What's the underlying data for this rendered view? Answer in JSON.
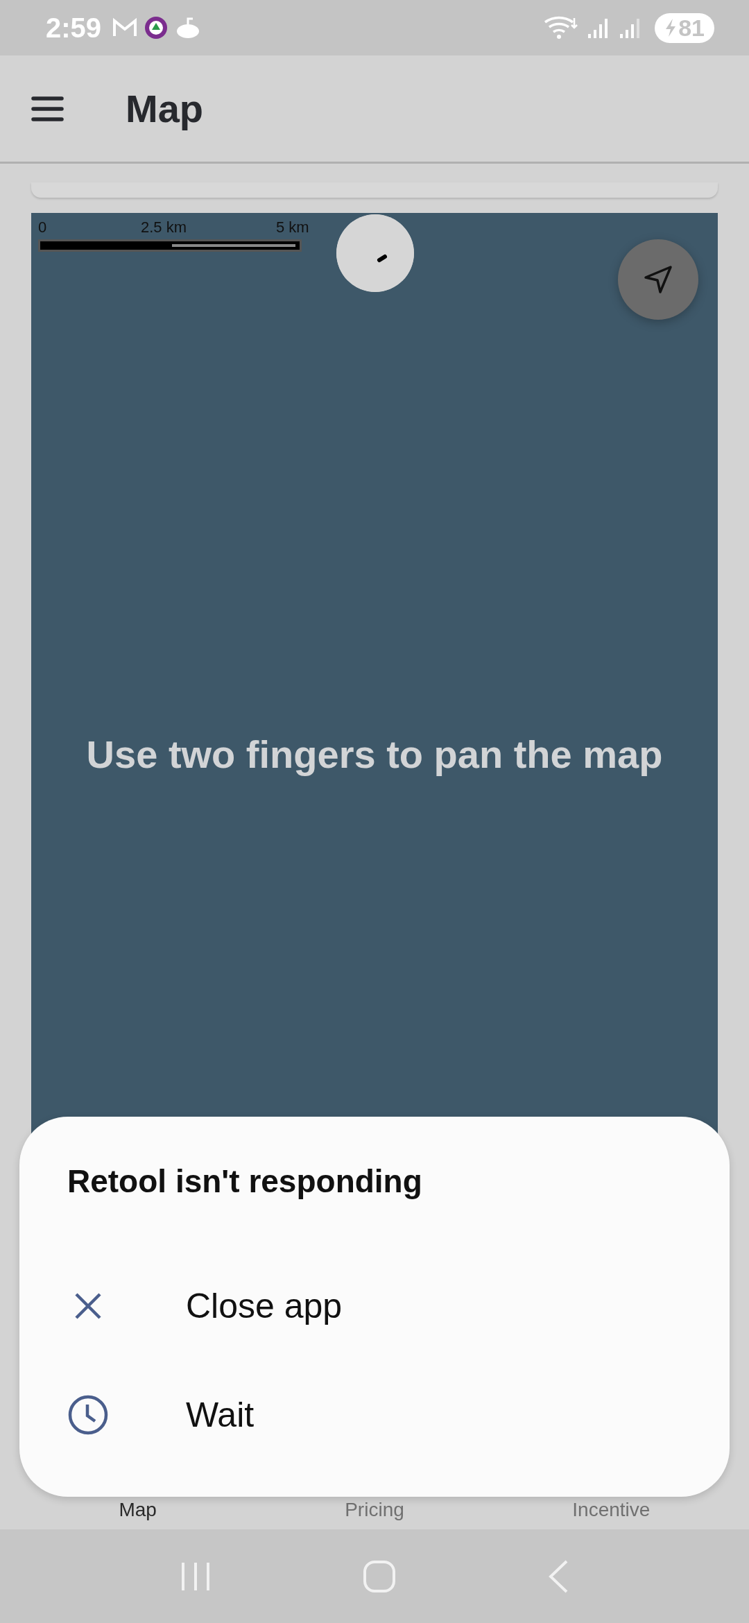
{
  "status_bar": {
    "time": "2:59",
    "battery": "81"
  },
  "header": {
    "title": "Map"
  },
  "map": {
    "scale_labels": [
      "0",
      "2.5 km",
      "5 km"
    ],
    "hint": "Use two fingers to pan the map"
  },
  "bottom_nav": [
    {
      "label": "Map",
      "selected": true
    },
    {
      "label": "Pricing",
      "selected": false
    },
    {
      "label": "Incentive",
      "selected": false
    }
  ],
  "dialog": {
    "title": "Retool isn't responding",
    "actions": [
      {
        "kind": "close",
        "label": "Close app"
      },
      {
        "kind": "wait",
        "label": "Wait"
      }
    ]
  }
}
